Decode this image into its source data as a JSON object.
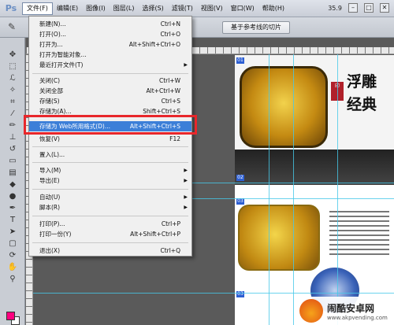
{
  "app": {
    "logo": "Ps",
    "zoom": "35.9"
  },
  "menubar": {
    "items": [
      "文件(F)",
      "编辑(E)",
      "图像(I)",
      "图层(L)",
      "选择(S)",
      "滤镜(T)",
      "视图(V)",
      "窗口(W)",
      "帮助(H)"
    ]
  },
  "window_controls": {
    "minimize": "–",
    "restore": "□",
    "close": "✕"
  },
  "options": {
    "slice_button": "基于参考线的切片"
  },
  "file_menu": {
    "items": [
      {
        "label": "新建(N)...",
        "shortcut": "Ctrl+N",
        "submenu": false,
        "enabled": true
      },
      {
        "label": "打开(O)...",
        "shortcut": "Ctrl+O",
        "submenu": false,
        "enabled": true
      },
      {
        "label": "打开为...",
        "shortcut": "Alt+Shift+Ctrl+O",
        "submenu": false,
        "enabled": true
      },
      {
        "label": "打开为智能对象...",
        "shortcut": "",
        "submenu": false,
        "enabled": true
      },
      {
        "label": "最近打开文件(T)",
        "shortcut": "",
        "submenu": true,
        "enabled": true
      },
      {
        "label": "关闭(C)",
        "shortcut": "Ctrl+W",
        "submenu": false,
        "enabled": true
      },
      {
        "label": "关闭全部",
        "shortcut": "Alt+Ctrl+W",
        "submenu": false,
        "enabled": true
      },
      {
        "label": "存储(S)",
        "shortcut": "Ctrl+S",
        "submenu": false,
        "enabled": true
      },
      {
        "label": "存储为(A)...",
        "shortcut": "Shift+Ctrl+S",
        "submenu": false,
        "enabled": true
      },
      {
        "label": "存储为 Web所用格式(D)...",
        "shortcut": "Alt+Shift+Ctrl+S",
        "submenu": false,
        "enabled": true,
        "highlighted": true
      },
      {
        "label": "恢复(V)",
        "shortcut": "F12",
        "submenu": false,
        "enabled": true
      },
      {
        "label": "置入(L)...",
        "shortcut": "",
        "submenu": false,
        "enabled": true
      },
      {
        "label": "导入(M)",
        "shortcut": "",
        "submenu": true,
        "enabled": true
      },
      {
        "label": "导出(E)",
        "shortcut": "",
        "submenu": true,
        "enabled": true
      },
      {
        "label": "自动(U)",
        "shortcut": "",
        "submenu": true,
        "enabled": true
      },
      {
        "label": "脚本(R)",
        "shortcut": "",
        "submenu": true,
        "enabled": true
      },
      {
        "label": "打印(P)...",
        "shortcut": "Ctrl+P",
        "submenu": false,
        "enabled": true
      },
      {
        "label": "打印一份(Y)",
        "shortcut": "Alt+Shift+Ctrl+P",
        "submenu": false,
        "enabled": true
      },
      {
        "label": "退出(X)",
        "shortcut": "Ctrl+Q",
        "submenu": false,
        "enabled": true
      }
    ]
  },
  "canvas": {
    "calligraphy": "浮雕经典",
    "stamp": "印",
    "slice_tags": [
      "01",
      "02",
      "03",
      "03"
    ]
  },
  "watermark": {
    "title": "闹酷安卓网",
    "url": "www.akpvending.com"
  },
  "colors": {
    "highlight": "#3c7fd8",
    "red_box": "#e8272b",
    "foreground": "#ff007f",
    "background": "#ffffff"
  },
  "icons": [
    "move-icon",
    "marquee-icon",
    "lasso-icon",
    "quick-select-icon",
    "crop-icon",
    "eyedropper-icon",
    "brush-icon",
    "stamp-icon",
    "eraser-icon",
    "gradient-icon",
    "pen-icon",
    "text-icon",
    "path-select-icon",
    "shape-icon",
    "hand-icon",
    "zoom-icon"
  ]
}
